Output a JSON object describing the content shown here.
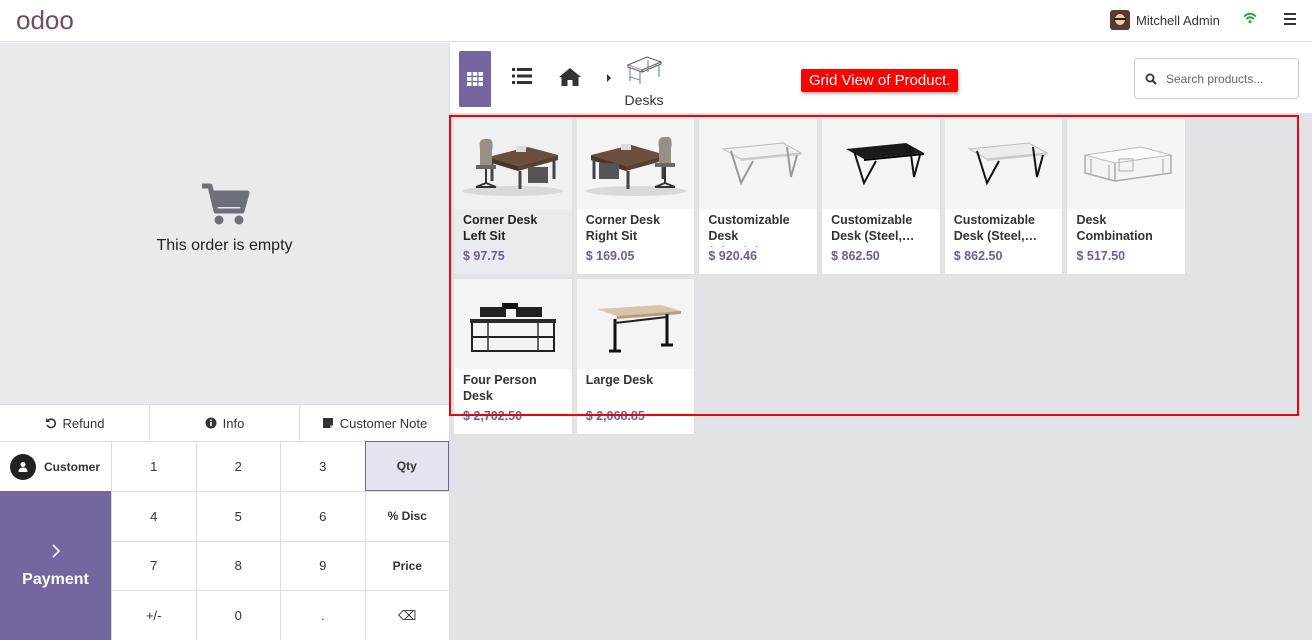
{
  "topbar": {
    "logo": "odoo",
    "user_name": "Mitchell Admin"
  },
  "order": {
    "empty_text": "This order is empty"
  },
  "actions": {
    "refund": "Refund",
    "info": "Info",
    "customer_note": "Customer Note"
  },
  "pad": {
    "customer": "Customer",
    "payment": "Payment",
    "keys": [
      "1",
      "2",
      "3",
      "Qty",
      "4",
      "5",
      "6",
      "% Disc",
      "7",
      "8",
      "9",
      "Price",
      "+/-",
      "0",
      ".",
      "⌫"
    ]
  },
  "categories": {
    "current": "Desks"
  },
  "annotation": "Grid View of Product.",
  "search": {
    "placeholder": "Search products..."
  },
  "products": [
    {
      "name": "Corner Desk Left Sit",
      "price": "$ 97.75"
    },
    {
      "name": "Corner Desk Right Sit",
      "price": "$ 169.05"
    },
    {
      "name": "Customizable Desk (Aluminiu…",
      "price": "$ 920.46"
    },
    {
      "name": "Customizable Desk (Steel,…",
      "price": "$ 862.50"
    },
    {
      "name": "Customizable Desk (Steel,…",
      "price": "$ 862.50"
    },
    {
      "name": "Desk Combination",
      "price": "$ 517.50"
    },
    {
      "name": "Four Person Desk",
      "price": "$ 2,702.50"
    },
    {
      "name": "Large Desk",
      "price": "$ 2,068.85"
    }
  ],
  "colors": {
    "brand": "#714b67",
    "accent": "#7566a0",
    "price": "#6f5c9c",
    "annotation": "#ff0000"
  }
}
